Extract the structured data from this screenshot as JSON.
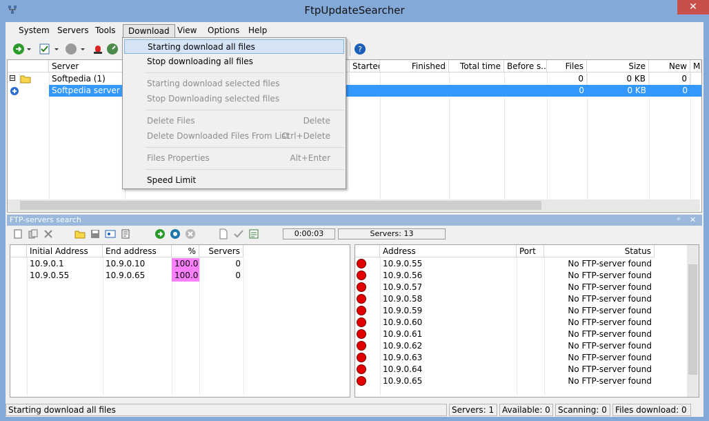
{
  "window": {
    "title": "FtpUpdateSearcher",
    "close_glyph": "✕"
  },
  "menubar": [
    "System",
    "Servers",
    "Tools",
    "Download",
    "View",
    "Options",
    "Help"
  ],
  "top_table": {
    "columns": [
      "Server",
      "Started",
      "Finished",
      "Total time",
      "Before s...",
      "Files",
      "Size",
      "New",
      "M"
    ],
    "rows": [
      {
        "expander": "⊟",
        "name": "Softpedia (1)",
        "files": "0",
        "size": "0 KB",
        "new": "0",
        "selected": false
      },
      {
        "expander": "",
        "name": "Softpedia server",
        "files": "0",
        "size": "0 KB",
        "new": "0",
        "selected": true
      }
    ]
  },
  "download_menu": {
    "items": [
      {
        "label": "Starting download all files",
        "shortcut": "",
        "disabled": false,
        "highlighted": true
      },
      {
        "label": "Stop downloading all files",
        "shortcut": "",
        "disabled": false,
        "highlighted": false
      },
      {
        "label": "Starting download selected files",
        "shortcut": "",
        "disabled": true,
        "highlighted": false
      },
      {
        "label": "Stop Downloading selected files",
        "shortcut": "",
        "disabled": true,
        "highlighted": false
      },
      {
        "label": "Delete Files",
        "shortcut": "Delete",
        "disabled": true,
        "highlighted": false
      },
      {
        "label": "Delete Downloaded Files From List",
        "shortcut": "Ctrl+Delete",
        "disabled": true,
        "highlighted": false
      },
      {
        "label": "Files Properties",
        "shortcut": "Alt+Enter",
        "disabled": true,
        "highlighted": false
      },
      {
        "label": "Speed Limit",
        "shortcut": "",
        "disabled": false,
        "highlighted": false
      }
    ]
  },
  "search_panel": {
    "title": "FTP-servers search",
    "timer": "0:00:03",
    "servers_count": "Servers: 13",
    "pin_glyph": "ᵖ",
    "close_glyph": "✕",
    "ranges_columns": [
      "Initial Address",
      "End address",
      "%",
      "Servers"
    ],
    "ranges": [
      {
        "initial": "10.9.0.1",
        "end": "10.9.0.10",
        "percent": "100.0",
        "servers": "0"
      },
      {
        "initial": "10.9.0.55",
        "end": "10.9.0.65",
        "percent": "100.0",
        "servers": "0"
      }
    ],
    "results_columns": [
      "Address",
      "Port",
      "Status"
    ],
    "results": [
      {
        "address": "10.9.0.55",
        "status": "No FTP-server found"
      },
      {
        "address": "10.9.0.56",
        "status": "No FTP-server found"
      },
      {
        "address": "10.9.0.57",
        "status": "No FTP-server found"
      },
      {
        "address": "10.9.0.58",
        "status": "No FTP-server found"
      },
      {
        "address": "10.9.0.59",
        "status": "No FTP-server found"
      },
      {
        "address": "10.9.0.60",
        "status": "No FTP-server found"
      },
      {
        "address": "10.9.0.61",
        "status": "No FTP-server found"
      },
      {
        "address": "10.9.0.62",
        "status": "No FTP-server found"
      },
      {
        "address": "10.9.0.63",
        "status": "No FTP-server found"
      },
      {
        "address": "10.9.0.64",
        "status": "No FTP-server found"
      },
      {
        "address": "10.9.0.65",
        "status": "No FTP-server found"
      }
    ]
  },
  "statusbar": {
    "message": "Starting download all files",
    "servers": "Servers:  1",
    "available": "Available:  0",
    "scanning": "Scanning:  0",
    "files_download": "Files download:  0"
  },
  "colors": {
    "selection": "#3399ff",
    "percent_bg": "#ff80ff",
    "status_dot": "#e00000"
  }
}
